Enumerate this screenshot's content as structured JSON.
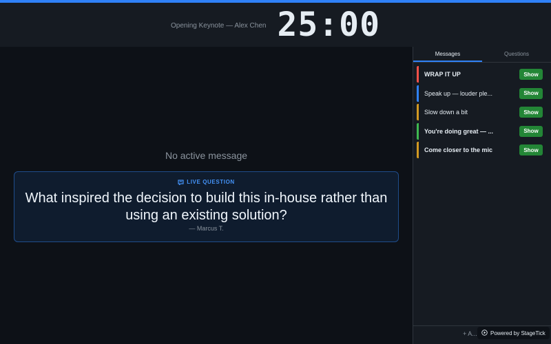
{
  "colors": {
    "accent": "#2f81f7",
    "show_button": "#238636",
    "priority_red": "#f85149",
    "priority_blue": "#2f81f7",
    "priority_yellow": "#d29922",
    "priority_green": "#3fb950"
  },
  "header": {
    "session_title": "Opening Keynote — Alex Chen",
    "timer": "25:00"
  },
  "stage": {
    "no_message": "No active message",
    "question": {
      "label": "LIVE QUESTION",
      "icon": "speech-bubble-icon",
      "text": "What inspired the decision to build this in-house rather than using an existing solution?",
      "author": "— Marcus T."
    }
  },
  "sidebar": {
    "tabs": [
      {
        "label": "Messages",
        "active": true
      },
      {
        "label": "Questions",
        "active": false
      }
    ],
    "messages": [
      {
        "text": "WRAP IT UP",
        "bold": true,
        "color": "#f85149",
        "button": "Show"
      },
      {
        "text": "Speak up — louder ple...",
        "bold": false,
        "color": "#2f81f7",
        "button": "Show"
      },
      {
        "text": "Slow down a bit",
        "bold": false,
        "color": "#d29922",
        "button": "Show"
      },
      {
        "text": "You're doing great — ...",
        "bold": true,
        "color": "#3fb950",
        "button": "Show"
      },
      {
        "text": "Come closer to the mic",
        "bold": true,
        "color": "#d29922",
        "button": "Show"
      }
    ],
    "footer": {
      "add_label": "+ A..."
    }
  },
  "badge": {
    "label": "Powered by StageTick",
    "icon": "play-circle-icon"
  }
}
